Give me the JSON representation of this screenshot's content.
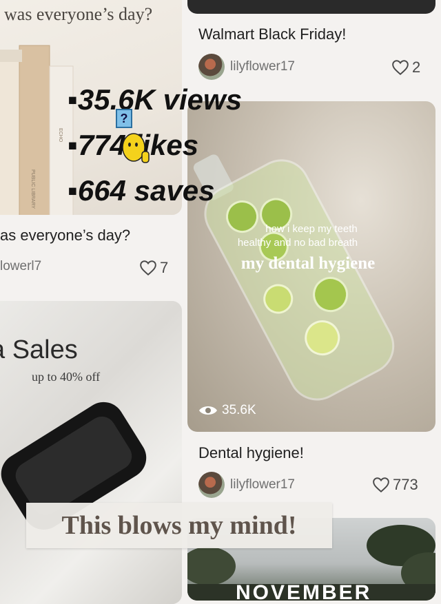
{
  "left_top_card": {
    "image_caption": "was everyone’s day?",
    "title": "as everyone’s day?",
    "author": "lowerl7",
    "likes": "7"
  },
  "overlay_stats": {
    "views": "▪35.6K views",
    "likes": "▪774 likes",
    "saves": "▪664 saves",
    "question_mark": "?"
  },
  "right_top_card": {
    "title": "Walmart Black Friday!",
    "author": "lilyflower17",
    "likes": "2"
  },
  "dental_card": {
    "subtitle_line1": "how i keep my teeth",
    "subtitle_line2": "healthy and no bad breath",
    "heading": "my dental hygiene",
    "views": "35.6K",
    "title": "Dental hygiene!",
    "author": "lilyflower17",
    "likes": "773"
  },
  "sales_card": {
    "heading": "a Sales",
    "subheading": "up to 40% off"
  },
  "banner": {
    "text": "This blows my mind!"
  },
  "bottom_right_card": {
    "partial_text": "NOVEMBER"
  }
}
